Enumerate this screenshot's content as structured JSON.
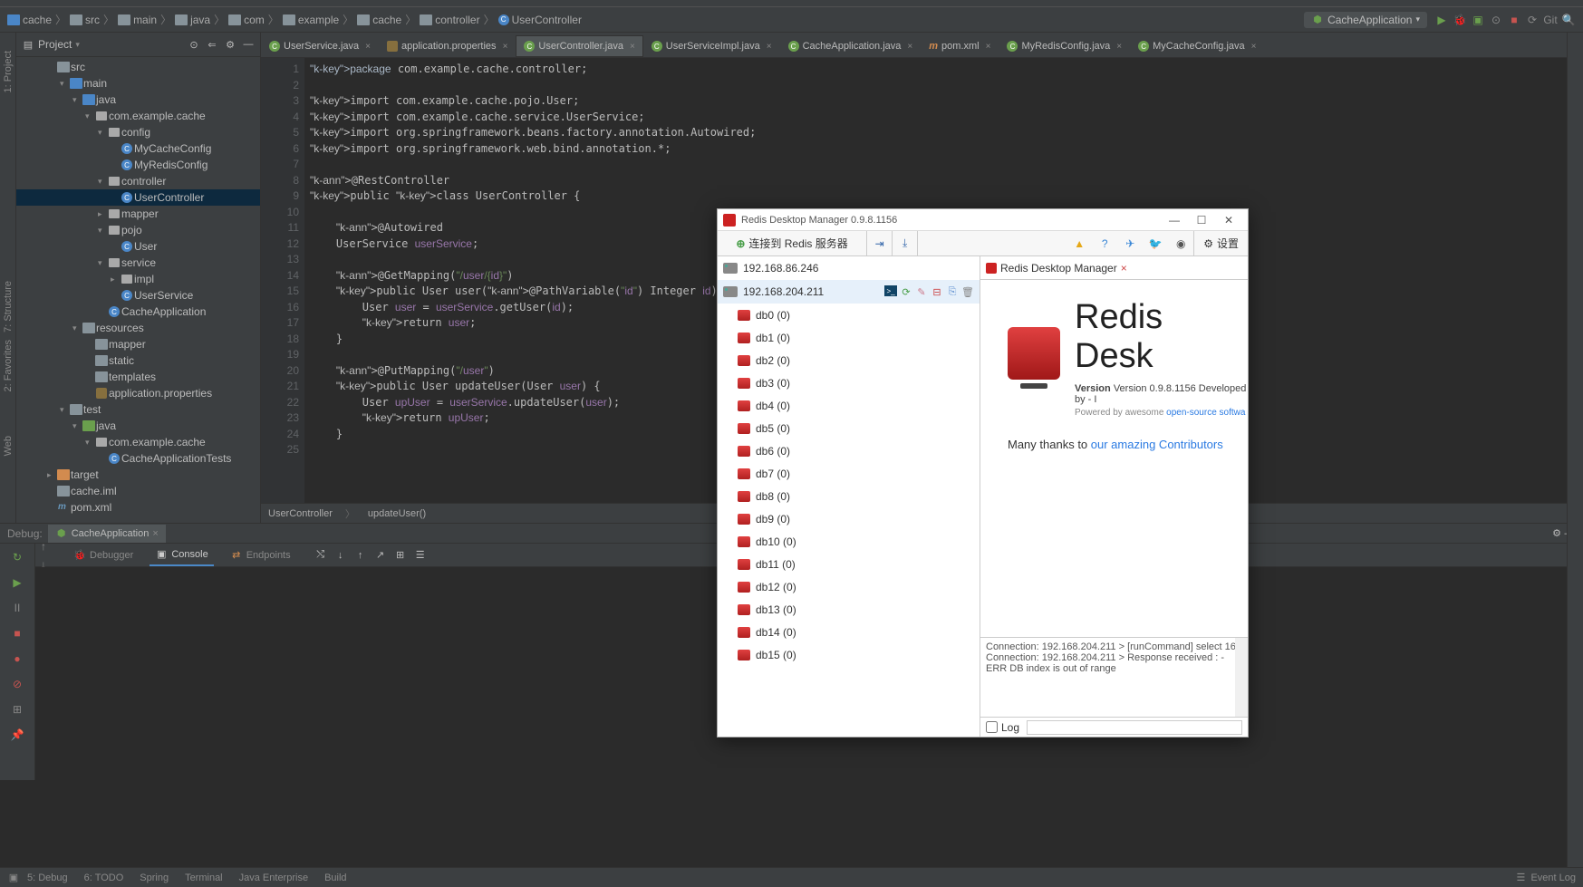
{
  "breadcrumb": [
    "cache",
    "src",
    "main",
    "java",
    "com",
    "example",
    "cache",
    "controller",
    "UserController"
  ],
  "run_config": "CacheApplication",
  "project": {
    "title": "Project",
    "tree": [
      {
        "label": "src",
        "indent": 2,
        "arrow": "",
        "fld": "dark"
      },
      {
        "label": "main",
        "indent": 3,
        "arrow": "▾",
        "fld": "blue"
      },
      {
        "label": "java",
        "indent": 4,
        "arrow": "▾",
        "fld": "blue"
      },
      {
        "label": "com.example.cache",
        "indent": 5,
        "arrow": "▾",
        "fld": "pkg"
      },
      {
        "label": "config",
        "indent": 6,
        "arrow": "▾",
        "fld": "pkg"
      },
      {
        "label": "MyCacheConfig",
        "indent": 7,
        "arrow": "",
        "fld": "cls"
      },
      {
        "label": "MyRedisConfig",
        "indent": 7,
        "arrow": "",
        "fld": "cls"
      },
      {
        "label": "controller",
        "indent": 6,
        "arrow": "▾",
        "fld": "pkg"
      },
      {
        "label": "UserController",
        "indent": 7,
        "arrow": "",
        "fld": "cls",
        "sel": true
      },
      {
        "label": "mapper",
        "indent": 6,
        "arrow": "▸",
        "fld": "pkg"
      },
      {
        "label": "pojo",
        "indent": 6,
        "arrow": "▾",
        "fld": "pkg"
      },
      {
        "label": "User",
        "indent": 7,
        "arrow": "",
        "fld": "cls"
      },
      {
        "label": "service",
        "indent": 6,
        "arrow": "▾",
        "fld": "pkg"
      },
      {
        "label": "impl",
        "indent": 7,
        "arrow": "▸",
        "fld": "pkg"
      },
      {
        "label": "UserService",
        "indent": 7,
        "arrow": "",
        "fld": "cls"
      },
      {
        "label": "CacheApplication",
        "indent": 6,
        "arrow": "",
        "fld": "cls"
      },
      {
        "label": "resources",
        "indent": 4,
        "arrow": "▾",
        "fld": "dark"
      },
      {
        "label": "mapper",
        "indent": 5,
        "arrow": "",
        "fld": "dark"
      },
      {
        "label": "static",
        "indent": 5,
        "arrow": "",
        "fld": "dark"
      },
      {
        "label": "templates",
        "indent": 5,
        "arrow": "",
        "fld": "dark"
      },
      {
        "label": "application.properties",
        "indent": 5,
        "arrow": "",
        "fld": "prop"
      },
      {
        "label": "test",
        "indent": 3,
        "arrow": "▾",
        "fld": "dark"
      },
      {
        "label": "java",
        "indent": 4,
        "arrow": "▾",
        "fld": "green"
      },
      {
        "label": "com.example.cache",
        "indent": 5,
        "arrow": "▾",
        "fld": "pkg"
      },
      {
        "label": "CacheApplicationTests",
        "indent": 6,
        "arrow": "",
        "fld": "cls"
      },
      {
        "label": "target",
        "indent": 2,
        "arrow": "▸",
        "fld": "orange"
      },
      {
        "label": "cache.iml",
        "indent": 2,
        "arrow": "",
        "fld": "file"
      },
      {
        "label": "pom.xml",
        "indent": 2,
        "arrow": "",
        "fld": "xml"
      }
    ]
  },
  "tabs": [
    {
      "label": "UserService.java",
      "icon": "c"
    },
    {
      "label": "application.properties",
      "icon": "p"
    },
    {
      "label": "UserController.java",
      "icon": "c",
      "active": true
    },
    {
      "label": "UserServiceImpl.java",
      "icon": "c"
    },
    {
      "label": "CacheApplication.java",
      "icon": "c"
    },
    {
      "label": "pom.xml",
      "icon": "x"
    },
    {
      "label": "MyRedisConfig.java",
      "icon": "c"
    },
    {
      "label": "MyCacheConfig.java",
      "icon": "c"
    }
  ],
  "code": {
    "lines": [
      1,
      2,
      3,
      4,
      5,
      6,
      7,
      8,
      9,
      10,
      11,
      12,
      13,
      14,
      15,
      16,
      17,
      18,
      19,
      20,
      21,
      22,
      23,
      24,
      25
    ],
    "text": "package com.example.cache.controller;\n\nimport com.example.cache.pojo.User;\nimport com.example.cache.service.UserService;\nimport org.springframework.beans.factory.annotation.Autowired;\nimport org.springframework.web.bind.annotation.*;\n\n@RestController\npublic class UserController {\n\n    @Autowired\n    UserService userService;\n\n    @GetMapping(\"/user/{id}\")\n    public User user(@PathVariable(\"id\") Integer id){\n        User user = userService.getUser(id);\n        return user;\n    }\n\n    @PutMapping(\"/user\")\n    public User updateUser(User user) {\n        User upUser = userService.updateUser(user);\n        return upUser;\n    }\n"
  },
  "crumb1": "UserController",
  "crumb2": "updateUser()",
  "debug": {
    "label": "Debug:",
    "app": "CacheApplication",
    "tabs": {
      "debugger": "Debugger",
      "console": "Console",
      "endpoints": "Endpoints"
    }
  },
  "status_left": [
    "5: Debug",
    "6: TODO",
    "Spring",
    "Terminal",
    "Java Enterprise",
    "Build"
  ],
  "status_right": "Event Log",
  "sidebars": {
    "project": "1: Project",
    "structure": "7: Structure",
    "favorites": "2: Favorites",
    "web": "Web"
  },
  "redis": {
    "title": "Redis Desktop Manager 0.9.8.1156",
    "connect": "连接到 Redis 服务器",
    "settings": "设置",
    "servers": [
      "192.168.86.246",
      "192.168.204.211"
    ],
    "dbs": [
      "db0  (0)",
      "db1  (0)",
      "db2  (0)",
      "db3  (0)",
      "db4  (0)",
      "db5  (0)",
      "db6  (0)",
      "db7  (0)",
      "db8  (0)",
      "db9  (0)",
      "db10  (0)",
      "db11  (0)",
      "db12  (0)",
      "db13  (0)",
      "db14  (0)",
      "db15  (0)"
    ],
    "tab_title": "Redis Desktop Manager",
    "big": "Redis Desk",
    "version_line": "Version 0.9.8.1156    Developed by - I",
    "powered": "Powered by awesome ",
    "powered_link": "open-source softwa",
    "thanks_pre": "Many thanks to ",
    "thanks_link": "our amazing Contributors",
    "log_label": "Log",
    "log_lines": [
      "Connection: 192.168.204.211 > [runCommand] select 16",
      "Connection: 192.168.204.211 > Response received : -ERR DB index is out of range"
    ]
  }
}
